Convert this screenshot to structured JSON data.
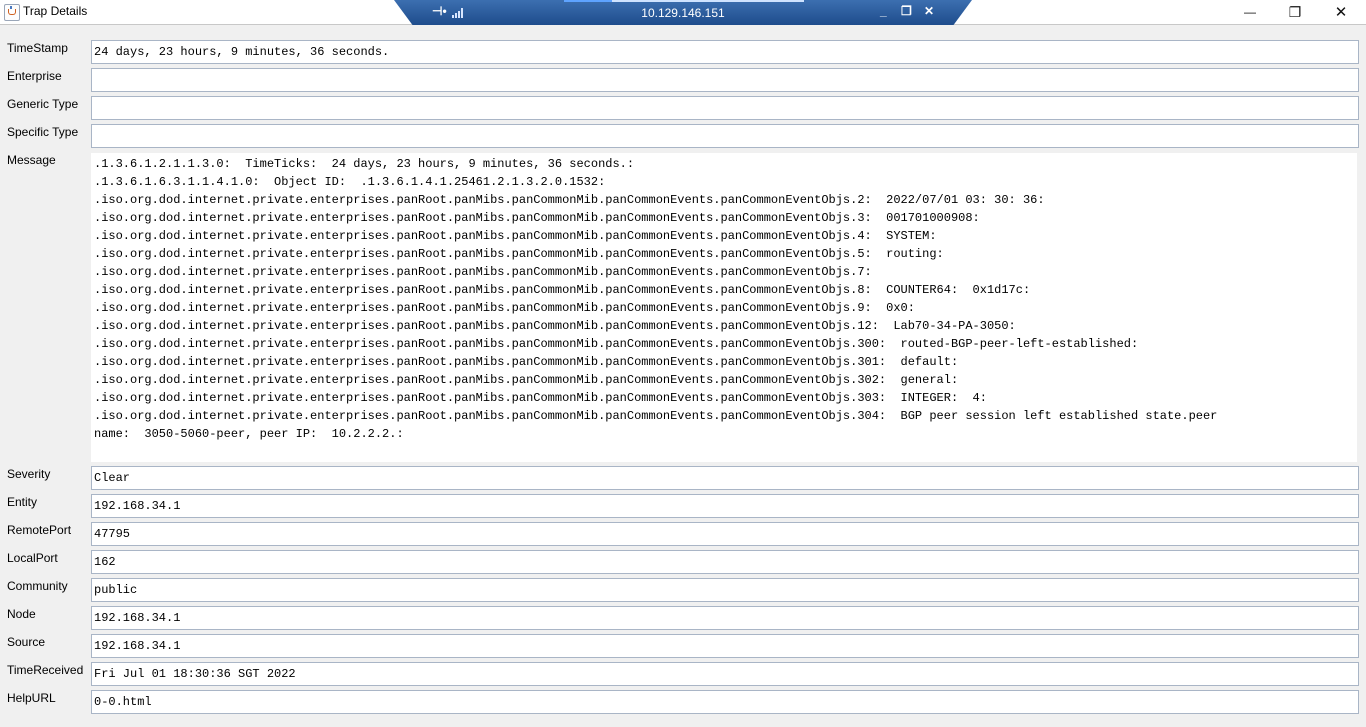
{
  "window": {
    "title": "Trap Details",
    "controls": {
      "minimize": "—",
      "maximize": "❐",
      "close": "✕"
    }
  },
  "remote_bar": {
    "host": "10.129.146.151",
    "icons": [
      "pin-icon",
      "signal-icon",
      "minimize-icon",
      "restore-icon",
      "close-icon"
    ]
  },
  "fields": {
    "timestamp": {
      "label": "TimeStamp",
      "value": "24 days, 23 hours, 9 minutes, 36 seconds."
    },
    "enterprise": {
      "label": "Enterprise",
      "value": ""
    },
    "generic_type": {
      "label": "Generic Type",
      "value": ""
    },
    "specific_type": {
      "label": "Specific Type",
      "value": ""
    },
    "message": {
      "label": "Message",
      "lines": [
        ".1.3.6.1.2.1.1.3.0:  TimeTicks:  24 days, 23 hours, 9 minutes, 36 seconds.:",
        ".1.3.6.1.6.3.1.1.4.1.0:  Object ID:  .1.3.6.1.4.1.25461.2.1.3.2.0.1532:",
        ".iso.org.dod.internet.private.enterprises.panRoot.panMibs.panCommonMib.panCommonEvents.panCommonEventObjs.2:  2022/07/01 03: 30: 36:",
        ".iso.org.dod.internet.private.enterprises.panRoot.panMibs.panCommonMib.panCommonEvents.panCommonEventObjs.3:  001701000908:",
        ".iso.org.dod.internet.private.enterprises.panRoot.panMibs.panCommonMib.panCommonEvents.panCommonEventObjs.4:  SYSTEM:",
        ".iso.org.dod.internet.private.enterprises.panRoot.panMibs.panCommonMib.panCommonEvents.panCommonEventObjs.5:  routing:",
        ".iso.org.dod.internet.private.enterprises.panRoot.panMibs.panCommonMib.panCommonEvents.panCommonEventObjs.7:",
        ".iso.org.dod.internet.private.enterprises.panRoot.panMibs.panCommonMib.panCommonEvents.panCommonEventObjs.8:  COUNTER64:  0x1d17c:",
        ".iso.org.dod.internet.private.enterprises.panRoot.panMibs.panCommonMib.panCommonEvents.panCommonEventObjs.9:  0x0:",
        ".iso.org.dod.internet.private.enterprises.panRoot.panMibs.panCommonMib.panCommonEvents.panCommonEventObjs.12:  Lab70-34-PA-3050:",
        ".iso.org.dod.internet.private.enterprises.panRoot.panMibs.panCommonMib.panCommonEvents.panCommonEventObjs.300:  routed-BGP-peer-left-established:",
        ".iso.org.dod.internet.private.enterprises.panRoot.panMibs.panCommonMib.panCommonEvents.panCommonEventObjs.301:  default:",
        ".iso.org.dod.internet.private.enterprises.panRoot.panMibs.panCommonMib.panCommonEvents.panCommonEventObjs.302:  general:",
        ".iso.org.dod.internet.private.enterprises.panRoot.panMibs.panCommonMib.panCommonEvents.panCommonEventObjs.303:  INTEGER:  4:",
        ".iso.org.dod.internet.private.enterprises.panRoot.panMibs.panCommonMib.panCommonEvents.panCommonEventObjs.304:  BGP peer session left established state.peer",
        "name:  3050-5060-peer, peer IP:  10.2.2.2.:"
      ]
    },
    "severity": {
      "label": "Severity",
      "value": "Clear"
    },
    "entity": {
      "label": "Entity",
      "value": "192.168.34.1"
    },
    "remote_port": {
      "label": "RemotePort",
      "value": "47795"
    },
    "local_port": {
      "label": "LocalPort",
      "value": "162"
    },
    "community": {
      "label": "Community",
      "value": "public"
    },
    "node": {
      "label": "Node",
      "value": "192.168.34.1"
    },
    "source": {
      "label": "Source",
      "value": "192.168.34.1"
    },
    "time_received": {
      "label": "TimeReceived",
      "value": "Fri Jul 01 18:30:36 SGT 2022"
    },
    "help_url": {
      "label": "HelpURL",
      "value": "0-0.html"
    }
  }
}
